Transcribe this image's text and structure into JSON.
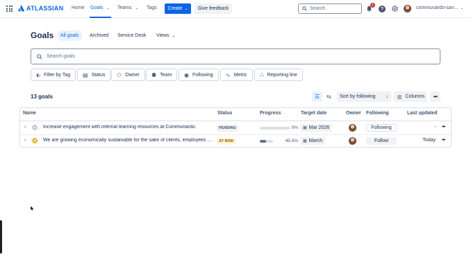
{
  "topnav": {
    "brand": "ATLASSIAN",
    "items": [
      "Home",
      "Goals",
      "Teams",
      "Tags"
    ],
    "create": "Create",
    "feedback": "Give feedback",
    "search_placeholder": "Search",
    "notification_count": "1",
    "help": "?",
    "user": "communardo-san..."
  },
  "page": {
    "title": "Goals",
    "tabs": [
      "All goals",
      "Archived",
      "Service Desk",
      "Views"
    ],
    "search_placeholder": "Search goals",
    "filters": [
      "Filter by Tag",
      "Status",
      "Owner",
      "Team",
      "Following",
      "Metric",
      "Reporting line"
    ]
  },
  "toolbar": {
    "count": "13 goals",
    "sort": "Sort by following",
    "columns": "Columns",
    "more": "•••"
  },
  "table": {
    "headers": [
      "Name",
      "Status",
      "Progress",
      "Target date",
      "Owner",
      "Following",
      "Last updated"
    ],
    "rows": [
      {
        "name": "Increase engagement with internal learning resources at Communardo.",
        "status": "PENDING",
        "progress": 0,
        "progress_text": "0%",
        "target_date": "Mar 2026",
        "following": "Following",
        "last_updated": "-",
        "more": "•••"
      },
      {
        "name": "We are growing economically sustainable for the sake of clients, employees and shareholders",
        "status": "AT RISK",
        "progress": 49.5,
        "progress_text": "49,5%",
        "target_date": "March",
        "following": "Follow",
        "last_updated": "Today",
        "more": "•••"
      }
    ]
  },
  "colors": {
    "accent": "#0c66e4",
    "pending_bg": "#f1f2f4",
    "pending_fg": "#44546f",
    "at_risk_bg": "#fff7d6",
    "at_risk_fg": "#a54800"
  }
}
